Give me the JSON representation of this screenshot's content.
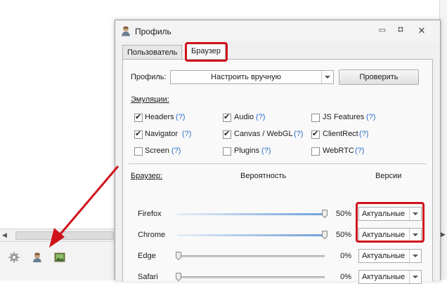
{
  "dialog": {
    "title": "Профиль",
    "tabs": [
      {
        "label": "Пользователь",
        "active": false
      },
      {
        "label": "Браузер",
        "active": true
      }
    ]
  },
  "profile": {
    "label": "Профиль:",
    "value": "Настроить вручную",
    "check_button": "Проверить"
  },
  "emulations": {
    "heading": "Эмуляции:",
    "help": "(?)",
    "items": [
      {
        "label": "Headers",
        "checked": true
      },
      {
        "label": "Audio",
        "checked": true
      },
      {
        "label": "JS Features",
        "checked": false
      },
      {
        "label": "Navigator",
        "checked": true
      },
      {
        "label": "Canvas / WebGL",
        "checked": true
      },
      {
        "label": "ClientRect",
        "checked": true
      },
      {
        "label": "Screen",
        "checked": false
      },
      {
        "label": "Plugins",
        "checked": false
      },
      {
        "label": "WebRTC",
        "checked": false
      }
    ]
  },
  "browsers": {
    "heading": "Браузер:",
    "probability_header": "Вероятность",
    "versions_header": "Версии",
    "rows": [
      {
        "name": "Firefox",
        "probability": 0.5,
        "percent": "50%",
        "version": "Актуальные"
      },
      {
        "name": "Chrome",
        "probability": 0.5,
        "percent": "50%",
        "version": "Актуальные"
      },
      {
        "name": "Edge",
        "probability": 0,
        "percent": "0%",
        "version": "Актуальные"
      },
      {
        "name": "Safari",
        "probability": 0,
        "percent": "0%",
        "version": "Актуальные"
      }
    ]
  },
  "colors": {
    "highlight": "#d0121b",
    "accent_blue": "#2a6fc9"
  },
  "icons": {
    "title": "user-icon",
    "bottom_bar": [
      "gear-icon",
      "user-profile-icon",
      "image-icon"
    ]
  }
}
